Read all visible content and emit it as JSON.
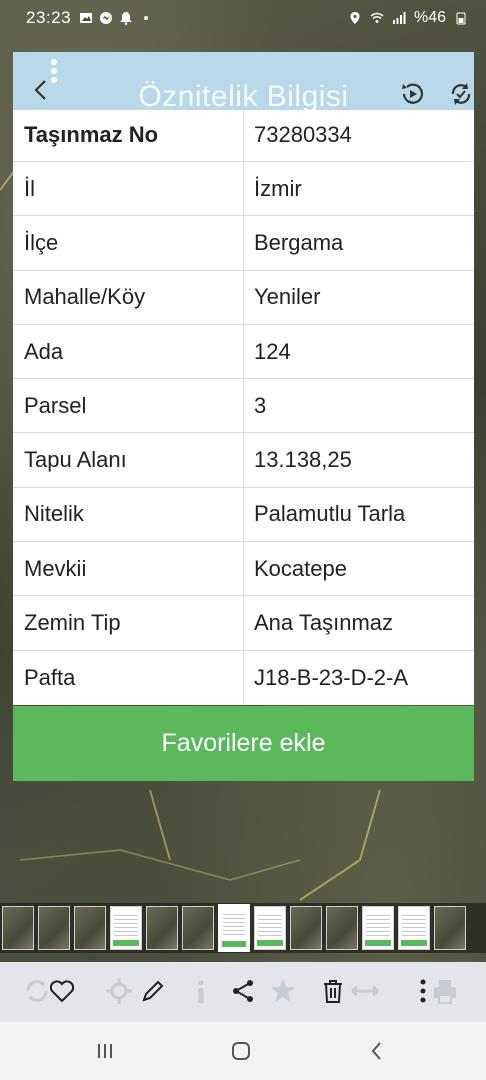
{
  "status_bar": {
    "time": "23:23",
    "battery": "%46"
  },
  "header": {
    "title": "Öznitelik Bilgisi"
  },
  "attributes": [
    {
      "key": "Taşınmaz No",
      "value": "73280334"
    },
    {
      "key": "İl",
      "value": "İzmir"
    },
    {
      "key": "İlçe",
      "value": "Bergama"
    },
    {
      "key": "Mahalle/Köy",
      "value": "Yeniler"
    },
    {
      "key": "Ada",
      "value": "124"
    },
    {
      "key": "Parsel",
      "value": "3"
    },
    {
      "key": "Tapu Alanı",
      "value": "13.138,25"
    },
    {
      "key": "Nitelik",
      "value": "Palamutlu Tarla"
    },
    {
      "key": "Mevkii",
      "value": "Kocatepe"
    },
    {
      "key": "Zemin Tip",
      "value": "Ana Taşınmaz"
    },
    {
      "key": "Pafta",
      "value": "J18-B-23-D-2-A"
    }
  ],
  "favorite_button": {
    "label": "Favorilere ekle"
  },
  "toolbar": {
    "icons": [
      "refresh-icon",
      "heart-icon",
      "crosshair-icon",
      "pencil-icon",
      "info-icon",
      "share-icon",
      "star-icon",
      "trash-icon",
      "measure-icon",
      "more-icon",
      "print-icon"
    ]
  },
  "colors": {
    "accent_green": "#5cb85c",
    "header_blue": "#b9d8ea"
  }
}
